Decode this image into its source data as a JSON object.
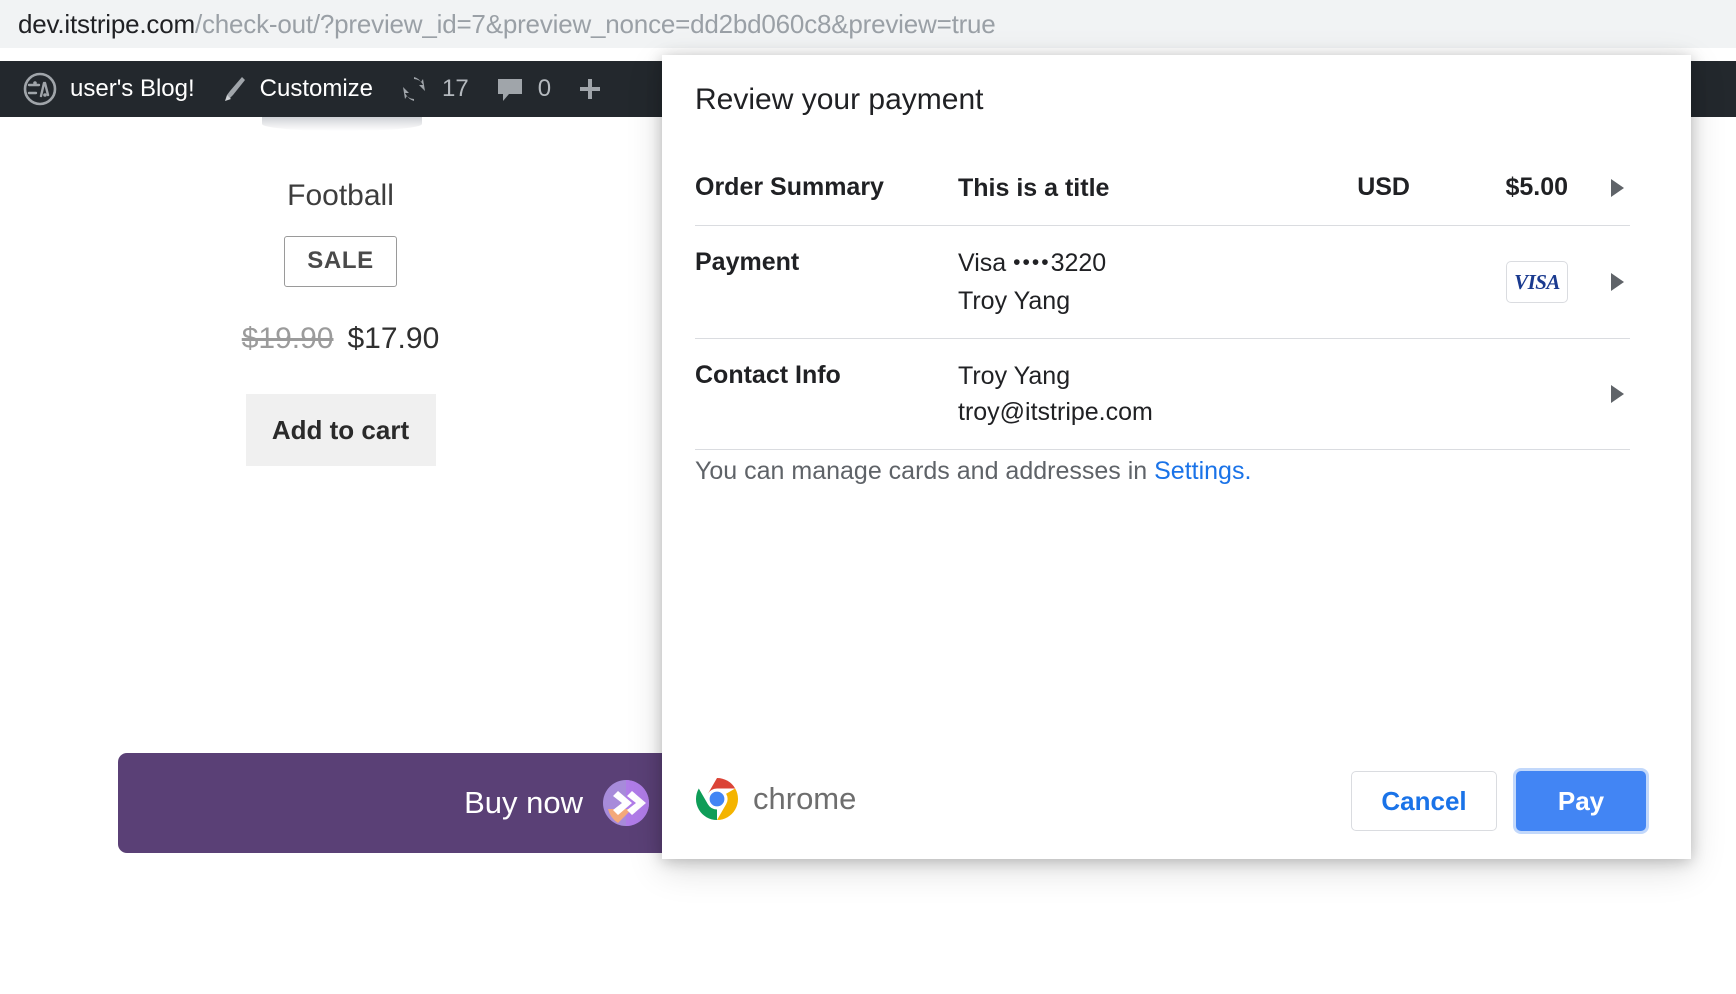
{
  "browser": {
    "url_host": "dev.itstripe.com",
    "url_path": "/check-out/?preview_id=7&preview_nonce=dd2bd060c8&preview=true"
  },
  "admin_bar": {
    "site_name": "user's Blog!",
    "customize_label": "Customize",
    "updates_count": "17",
    "comments_count": "0",
    "new_label": "+",
    "icons": {
      "wordpress": "wordpress-logo-icon",
      "customize": "brush-icon",
      "updates": "update-refresh-icon",
      "comments": "comment-bubble-icon",
      "new": "plus-icon"
    }
  },
  "product": {
    "title": "Football",
    "badge": "SALE",
    "price_old": "$19.90",
    "price_new": "$17.90",
    "add_to_cart_label": "Add to cart",
    "buy_now_label": "Buy now"
  },
  "dialog": {
    "title": "Review your payment",
    "rows": [
      {
        "label": "Order Summary",
        "main": "This is a title",
        "currency": "USD",
        "amount": "$5.00"
      },
      {
        "label": "Payment",
        "main_line1_brand": "Visa",
        "main_line1_dots": "••••",
        "main_line1_last4": "3220",
        "main_line2": "Troy Yang",
        "card_badge": "VISA"
      },
      {
        "label": "Contact Info",
        "main_line1": "Troy Yang",
        "main_line2": "troy@itstripe.com"
      }
    ],
    "manage_text": "You can manage cards and addresses in",
    "manage_link": "Settings.",
    "footer": {
      "brand": "chrome",
      "cancel_label": "Cancel",
      "pay_label": "Pay"
    }
  },
  "colors": {
    "admin_bar_bg": "#23282d",
    "url_bar_bg": "#f1f3f4",
    "link_blue": "#1a73e8",
    "pay_blue": "#4285f4",
    "buy_now_purple": "#5a4076",
    "visa_blue": "#1a3a8f"
  }
}
